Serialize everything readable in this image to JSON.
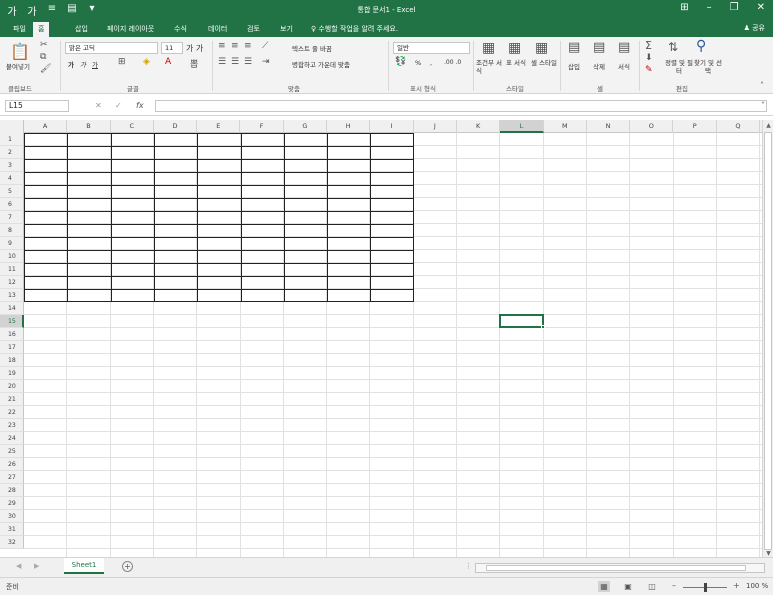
{
  "title_bar": {
    "title": "통합 문서1 - Excel",
    "qat": [
      {
        "icon": "font-increase-icon",
        "glyph": "가"
      },
      {
        "icon": "font-decrease-icon",
        "glyph": "가"
      },
      {
        "icon": "align-icon",
        "glyph": "≡"
      },
      {
        "icon": "save-icon",
        "glyph": "▤"
      },
      {
        "icon": "qat-dropdown-icon",
        "glyph": "▾"
      }
    ],
    "controls": [
      {
        "icon": "ribbon-display-icon",
        "glyph": "⊞"
      },
      {
        "icon": "minimize-icon",
        "glyph": "–"
      },
      {
        "icon": "restore-icon",
        "glyph": "❐"
      },
      {
        "icon": "close-icon",
        "glyph": "✕"
      }
    ]
  },
  "tabs": {
    "items": [
      "파일",
      "홈",
      "삽입",
      "페이지 레이아웃",
      "수식",
      "데이터",
      "검토",
      "보기",
      "♀ 수행할 작업을 알려 주세요."
    ],
    "active": 1,
    "share": "♟ 공유"
  },
  "ribbon": {
    "clipboard": {
      "paste": "붙여넣기",
      "label": "클립보드"
    },
    "font": {
      "name": "맑은 고딕",
      "size": "11",
      "bold": "가",
      "italic": "가",
      "underline": "가",
      "label": "글꼴"
    },
    "alignment": {
      "wrap": "텍스트 줄 바꿈",
      "merge": "병합하고 가운데 맞춤",
      "label": "맞춤"
    },
    "number": {
      "format": "일반",
      "percent": "%",
      "comma": ",",
      "label": "표시 형식"
    },
    "styles": {
      "conditional": "조건부 서식",
      "table": "표 서식",
      "cell": "셀 스타일",
      "label": "스타일"
    },
    "cells": {
      "insert": "삽입",
      "delete": "삭제",
      "format": "서식",
      "label": "셀"
    },
    "editing": {
      "sort": "정렬 및 필터",
      "find": "찾기 및 선택",
      "label": "편집"
    }
  },
  "formula_bar": {
    "name_box": "L15",
    "cancel": "✕",
    "enter": "✓",
    "fx": "fx",
    "value": ""
  },
  "grid": {
    "columns": [
      "A",
      "B",
      "C",
      "D",
      "E",
      "F",
      "G",
      "H",
      "I",
      "J",
      "K",
      "L",
      "M",
      "N",
      "O",
      "P",
      "Q"
    ],
    "rows": [
      "1",
      "2",
      "3",
      "4",
      "5",
      "6",
      "7",
      "8",
      "9",
      "10",
      "11",
      "12",
      "13",
      "14",
      "15",
      "16",
      "17",
      "18",
      "19",
      "20",
      "21",
      "22",
      "23",
      "24",
      "25",
      "26",
      "27",
      "28",
      "29",
      "30",
      "31",
      "32"
    ],
    "selected_column": "L",
    "selected_row": "15"
  },
  "sheets": {
    "tabs": [
      "Sheet1"
    ],
    "add": "+"
  },
  "status_bar": {
    "status": "준비",
    "zoom_minus": "–",
    "zoom_plus": "+",
    "zoom": "100 %"
  }
}
